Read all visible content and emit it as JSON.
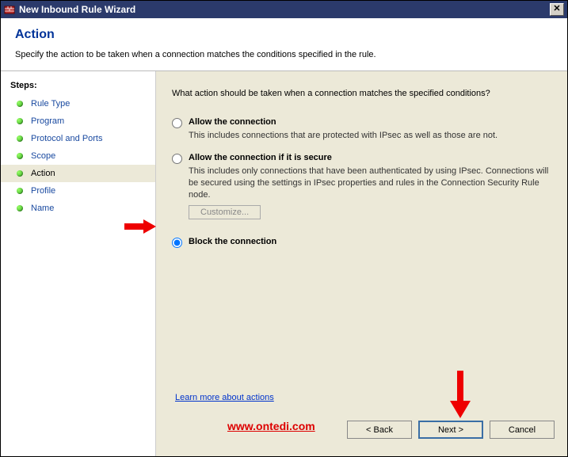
{
  "window": {
    "title": "New Inbound Rule Wizard",
    "close_glyph": "✕"
  },
  "header": {
    "title": "Action",
    "subtitle": "Specify the action to be taken when a connection matches the conditions specified in the rule."
  },
  "sidebar": {
    "label": "Steps:",
    "items": [
      {
        "label": "Rule Type",
        "active": false
      },
      {
        "label": "Program",
        "active": false
      },
      {
        "label": "Protocol and Ports",
        "active": false
      },
      {
        "label": "Scope",
        "active": false
      },
      {
        "label": "Action",
        "active": true
      },
      {
        "label": "Profile",
        "active": false
      },
      {
        "label": "Name",
        "active": false
      }
    ]
  },
  "main": {
    "prompt": "What action should be taken when a connection matches the specified conditions?",
    "options": {
      "allow": {
        "title": "Allow the connection",
        "desc": "This includes connections that are protected with IPsec as well as those are not."
      },
      "allow_secure": {
        "title": "Allow the connection if it is secure",
        "desc": "This includes only connections that have been authenticated by using IPsec.  Connections will be secured using the settings in IPsec properties and rules in the Connection Security Rule node.",
        "customize_label": "Customize..."
      },
      "block": {
        "title": "Block the connection"
      }
    },
    "learn_link": "Learn more about actions",
    "watermark": "www.ontedi.com"
  },
  "buttons": {
    "back": "< Back",
    "next": "Next >",
    "cancel": "Cancel"
  }
}
